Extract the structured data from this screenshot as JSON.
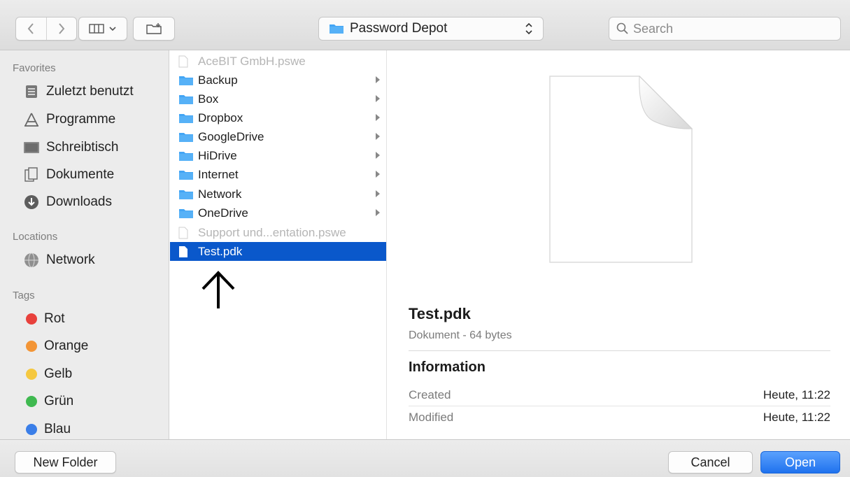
{
  "toolbar": {
    "location": "Password Depot",
    "search_placeholder": "Search"
  },
  "sidebar": {
    "favorites_header": "Favorites",
    "favorites": [
      {
        "label": "Zuletzt benutzt",
        "icon": "recents-icon"
      },
      {
        "label": "Programme",
        "icon": "applications-icon"
      },
      {
        "label": "Schreibtisch",
        "icon": "desktop-icon"
      },
      {
        "label": "Dokumente",
        "icon": "documents-icon"
      },
      {
        "label": "Downloads",
        "icon": "downloads-icon"
      }
    ],
    "locations_header": "Locations",
    "locations": [
      {
        "label": "Network",
        "icon": "network-globe-icon"
      }
    ],
    "tags_header": "Tags",
    "tags": [
      {
        "label": "Rot",
        "color": "#e8413c"
      },
      {
        "label": "Orange",
        "color": "#f39536"
      },
      {
        "label": "Gelb",
        "color": "#f5c840"
      },
      {
        "label": "Grün",
        "color": "#3fb950"
      },
      {
        "label": "Blau",
        "color": "#3a7ee8"
      }
    ]
  },
  "files": [
    {
      "name": "AceBIT GmbH.pswe",
      "type": "file",
      "dim": true
    },
    {
      "name": "Backup",
      "type": "folder"
    },
    {
      "name": "Box",
      "type": "folder"
    },
    {
      "name": "Dropbox",
      "type": "folder"
    },
    {
      "name": "GoogleDrive",
      "type": "folder"
    },
    {
      "name": "HiDrive",
      "type": "folder"
    },
    {
      "name": "Internet",
      "type": "folder"
    },
    {
      "name": "Network",
      "type": "folder"
    },
    {
      "name": "OneDrive",
      "type": "folder"
    },
    {
      "name": "Support und...entation.pswe",
      "type": "file",
      "dim": true
    },
    {
      "name": "Test.pdk",
      "type": "file",
      "selected": true
    }
  ],
  "preview": {
    "name": "Test.pdk",
    "kind": "Dokument - 64 bytes",
    "info_header": "Information",
    "created_label": "Created",
    "created_value": "Heute, 11:22",
    "modified_label": "Modified",
    "modified_value": "Heute, 11:22"
  },
  "buttons": {
    "new_folder": "New Folder",
    "cancel": "Cancel",
    "open": "Open"
  },
  "colors": {
    "accent": "#0a58cb",
    "folder": "#42a5f5"
  }
}
